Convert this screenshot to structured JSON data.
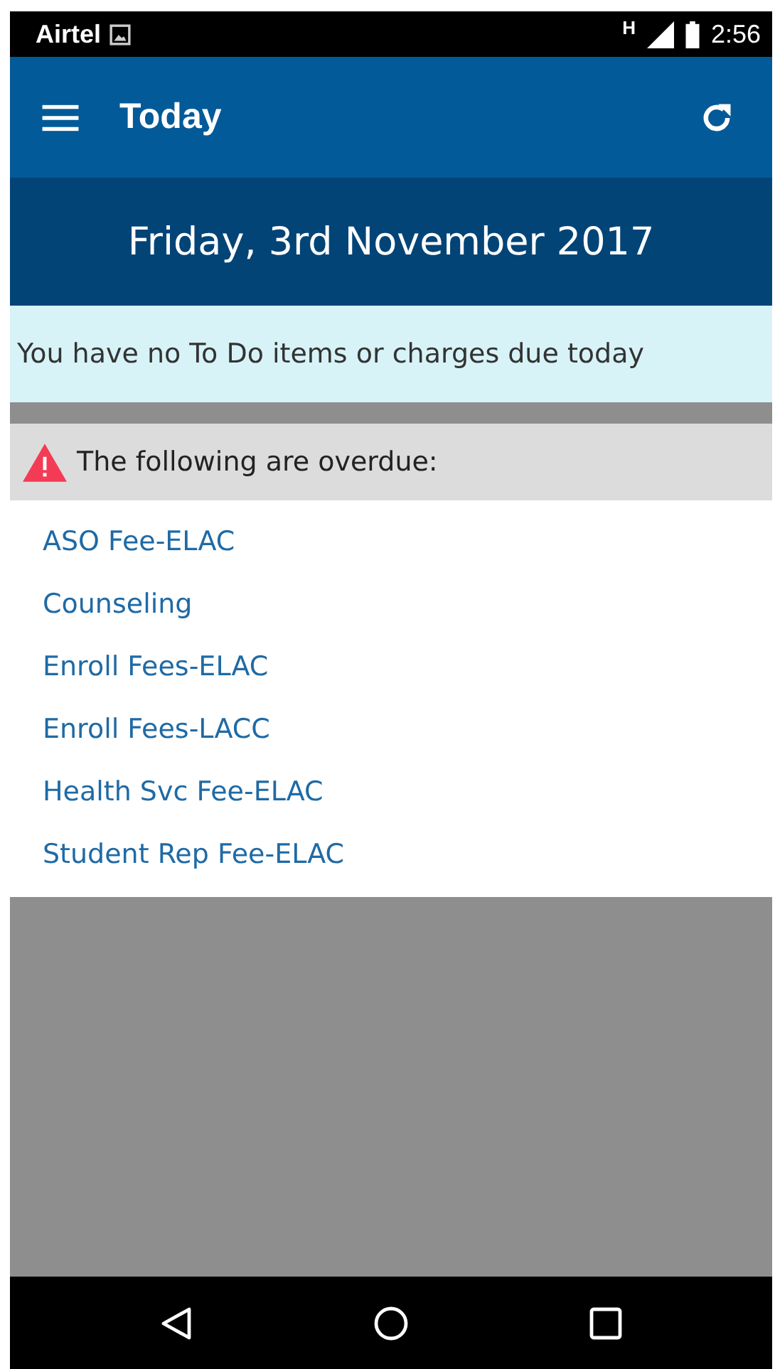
{
  "status_bar": {
    "carrier": "Airtel",
    "network": "H",
    "time": "2:56"
  },
  "app_bar": {
    "title": "Today"
  },
  "date": "Friday, 3rd November 2017",
  "notice": "You have no To Do items or charges due today",
  "overdue": {
    "heading": "The following are overdue:",
    "items": [
      "ASO Fee-ELAC",
      "Counseling",
      "Enroll Fees-ELAC",
      "Enroll Fees-LACC",
      "Health Svc Fee-ELAC",
      "Student Rep Fee-ELAC"
    ]
  }
}
